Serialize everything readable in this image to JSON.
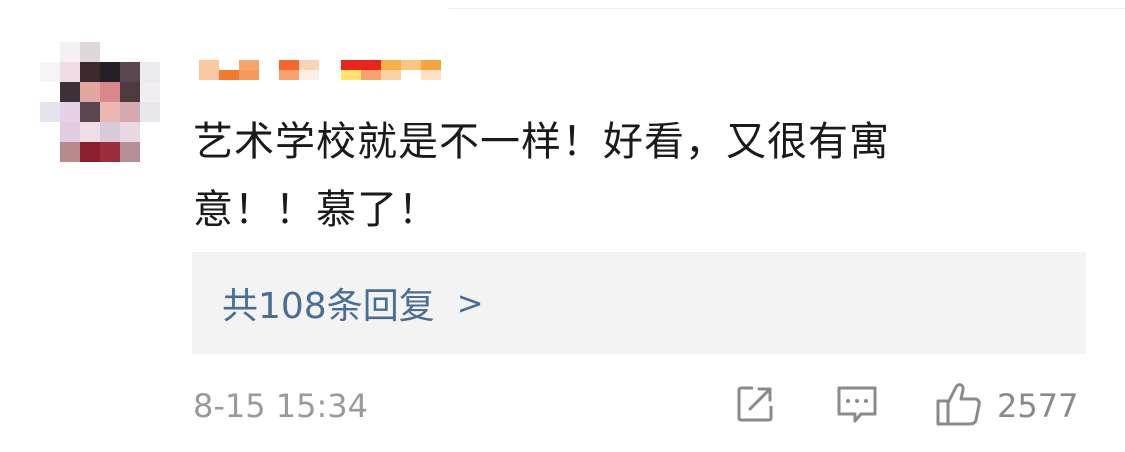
{
  "comment": {
    "text": "艺术学校就是不一样！好看，又很有寓意！！慕了！",
    "replies_label": "共108条回复",
    "replies_chevron": ">",
    "timestamp": "8-15 15:34",
    "like_count": "2577"
  },
  "icons": {
    "share": "share-icon",
    "comment": "comment-icon",
    "like": "thumbs-up-icon"
  },
  "colors": {
    "link": "#4a6d94",
    "meta": "#9a9a9a",
    "reply_box_bg": "#f3f3f4"
  }
}
